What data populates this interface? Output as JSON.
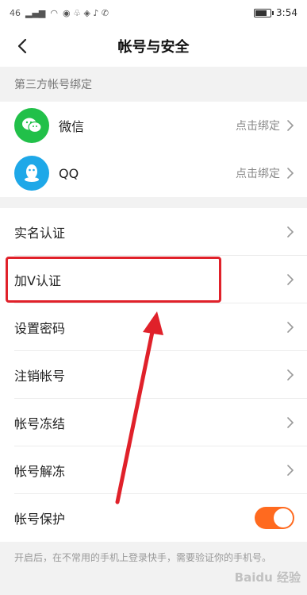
{
  "statusbar": {
    "signal": "46",
    "time": "3:54",
    "battery_level": 0.75
  },
  "nav": {
    "title": "帐号与安全"
  },
  "third_party": {
    "header": "第三方帐号绑定",
    "items": [
      {
        "name": "微信",
        "action": "点击绑定",
        "icon": "wechat-icon"
      },
      {
        "name": "QQ",
        "action": "点击绑定",
        "icon": "qq-icon"
      }
    ]
  },
  "menu": {
    "items": [
      {
        "label": "实名认证"
      },
      {
        "label": "加V认证"
      },
      {
        "label": "设置密码"
      },
      {
        "label": "注销帐号"
      },
      {
        "label": "帐号冻结"
      },
      {
        "label": "帐号解冻"
      }
    ],
    "protect_label": "帐号保护",
    "protect_on": true
  },
  "footnote": "开启后，在不常用的手机上登录快手，需要验证你的手机号。",
  "watermark": "Baidu 经验",
  "colors": {
    "accent": "#ff6a1f",
    "highlight": "#e0212a",
    "wechat": "#21c049",
    "qq": "#1ea8e8"
  }
}
